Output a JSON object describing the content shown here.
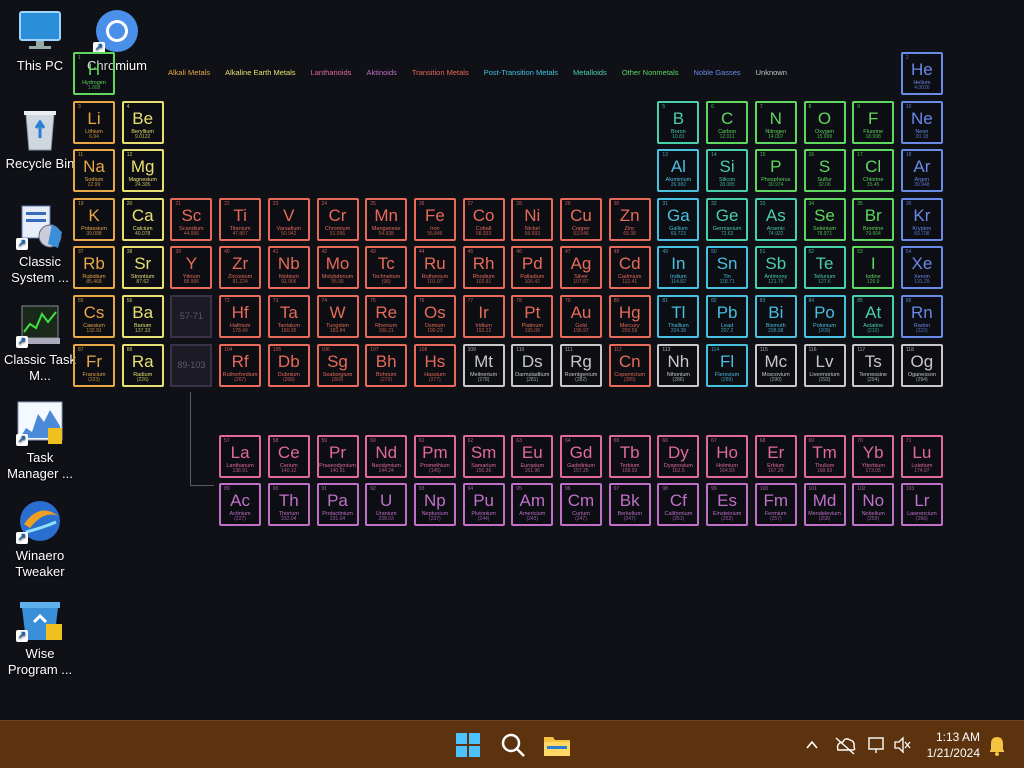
{
  "desktop": {
    "icons": [
      {
        "label": "This PC",
        "icon": "monitor-icon"
      },
      {
        "label": "Chromium",
        "icon": "chromium-icon"
      },
      {
        "label": "Recycle Bin",
        "icon": "recycle-bin-icon"
      },
      {
        "label": "Classic System ...",
        "icon": "system-properties-icon"
      },
      {
        "label": "Classic Task M...",
        "icon": "task-manager-icon"
      },
      {
        "label": "Task Manager ...",
        "icon": "task-manager-chart-icon"
      },
      {
        "label": "Winaero Tweaker",
        "icon": "winaero-icon"
      },
      {
        "label": "Wise Program ...",
        "icon": "wise-uninstaller-icon"
      }
    ]
  },
  "legend": [
    {
      "label": "Alkali Metals",
      "color": "#e8a848"
    },
    {
      "label": "Alkaline Earth Metals",
      "color": "#e8e070"
    },
    {
      "label": "Lanthanoids",
      "color": "#e06a9a"
    },
    {
      "label": "Aktinoids",
      "color": "#c070c8"
    },
    {
      "label": "Transition Metals",
      "color": "#e86a5a"
    },
    {
      "label": "Post-Transition Metals",
      "color": "#48c0e0"
    },
    {
      "label": "Metalloids",
      "color": "#48d0a8"
    },
    {
      "label": "Other Nonmetals",
      "color": "#60d860"
    },
    {
      "label": "Noble Gasses",
      "color": "#6a8ae8"
    },
    {
      "label": "Unknown",
      "color": "#c8c8c8"
    }
  ],
  "category_colors": {
    "alkali": "#e8a848",
    "alkaline": "#e8e070",
    "lanthanoid": "#e06a9a",
    "actinoid": "#c070c8",
    "transition": "#e86a5a",
    "post": "#48c0e0",
    "metalloid": "#48d0a8",
    "nonmetal": "#60d860",
    "noble": "#6a8ae8",
    "unknown": "#c8c8c8"
  },
  "elements": [
    [
      "1",
      "H",
      "Hydrogen",
      "1.008",
      1,
      1,
      "nonmetal"
    ],
    [
      "2",
      "He",
      "Helium",
      "4.0026",
      1,
      18,
      "noble"
    ],
    [
      "3",
      "Li",
      "Lithium",
      "6.94",
      2,
      1,
      "alkali"
    ],
    [
      "4",
      "Be",
      "Beryllium",
      "9.0122",
      2,
      2,
      "alkaline"
    ],
    [
      "5",
      "B",
      "Boron",
      "10.81",
      2,
      13,
      "metalloid"
    ],
    [
      "6",
      "C",
      "Carbon",
      "12.011",
      2,
      14,
      "nonmetal"
    ],
    [
      "7",
      "N",
      "Nitrogen",
      "14.007",
      2,
      15,
      "nonmetal"
    ],
    [
      "8",
      "O",
      "Oxygen",
      "15.999",
      2,
      16,
      "nonmetal"
    ],
    [
      "9",
      "F",
      "Fluorine",
      "18.998",
      2,
      17,
      "nonmetal"
    ],
    [
      "10",
      "Ne",
      "Neon",
      "20.18",
      2,
      18,
      "noble"
    ],
    [
      "11",
      "Na",
      "Sodium",
      "22.99",
      3,
      1,
      "alkali"
    ],
    [
      "12",
      "Mg",
      "Magnesium",
      "24.305",
      3,
      2,
      "alkaline"
    ],
    [
      "13",
      "Al",
      "Aluminium",
      "26.982",
      3,
      13,
      "post"
    ],
    [
      "14",
      "Si",
      "Silicon",
      "28.085",
      3,
      14,
      "metalloid"
    ],
    [
      "15",
      "P",
      "Phosphorus",
      "30.974",
      3,
      15,
      "nonmetal"
    ],
    [
      "16",
      "S",
      "Sulfur",
      "32.06",
      3,
      16,
      "nonmetal"
    ],
    [
      "17",
      "Cl",
      "Chlorine",
      "35.45",
      3,
      17,
      "nonmetal"
    ],
    [
      "18",
      "Ar",
      "Argon",
      "39.948",
      3,
      18,
      "noble"
    ],
    [
      "19",
      "K",
      "Potassium",
      "39.098",
      4,
      1,
      "alkali"
    ],
    [
      "20",
      "Ca",
      "Calcium",
      "40.078",
      4,
      2,
      "alkaline"
    ],
    [
      "21",
      "Sc",
      "Scandium",
      "44.956",
      4,
      3,
      "transition"
    ],
    [
      "22",
      "Ti",
      "Titanium",
      "47.867",
      4,
      4,
      "transition"
    ],
    [
      "23",
      "V",
      "Vanadium",
      "50.942",
      4,
      5,
      "transition"
    ],
    [
      "24",
      "Cr",
      "Chromium",
      "51.996",
      4,
      6,
      "transition"
    ],
    [
      "25",
      "Mn",
      "Manganese",
      "54.938",
      4,
      7,
      "transition"
    ],
    [
      "26",
      "Fe",
      "Iron",
      "55.845",
      4,
      8,
      "transition"
    ],
    [
      "27",
      "Co",
      "Cobalt",
      "58.933",
      4,
      9,
      "transition"
    ],
    [
      "28",
      "Ni",
      "Nickel",
      "58.693",
      4,
      10,
      "transition"
    ],
    [
      "29",
      "Cu",
      "Copper",
      "63.546",
      4,
      11,
      "transition"
    ],
    [
      "30",
      "Zn",
      "Zinc",
      "65.38",
      4,
      12,
      "transition"
    ],
    [
      "31",
      "Ga",
      "Gallium",
      "69.723",
      4,
      13,
      "post"
    ],
    [
      "32",
      "Ge",
      "Germanium",
      "72.63",
      4,
      14,
      "metalloid"
    ],
    [
      "33",
      "As",
      "Arsenic",
      "74.922",
      4,
      15,
      "metalloid"
    ],
    [
      "34",
      "Se",
      "Selenium",
      "78.971",
      4,
      16,
      "nonmetal"
    ],
    [
      "35",
      "Br",
      "Bromine",
      "79.904",
      4,
      17,
      "nonmetal"
    ],
    [
      "36",
      "Kr",
      "Krypton",
      "83.798",
      4,
      18,
      "noble"
    ],
    [
      "37",
      "Rb",
      "Rubidium",
      "85.468",
      5,
      1,
      "alkali"
    ],
    [
      "38",
      "Sr",
      "Strontium",
      "87.62",
      5,
      2,
      "alkaline"
    ],
    [
      "39",
      "Y",
      "Yttrium",
      "88.906",
      5,
      3,
      "transition"
    ],
    [
      "40",
      "Zr",
      "Zirconium",
      "91.224",
      5,
      4,
      "transition"
    ],
    [
      "41",
      "Nb",
      "Niobium",
      "92.906",
      5,
      5,
      "transition"
    ],
    [
      "42",
      "Mo",
      "Molybdenum",
      "95.95",
      5,
      6,
      "transition"
    ],
    [
      "43",
      "Tc",
      "Technetium",
      "(98)",
      5,
      7,
      "transition"
    ],
    [
      "44",
      "Ru",
      "Ruthenium",
      "101.07",
      5,
      8,
      "transition"
    ],
    [
      "45",
      "Rh",
      "Rhodium",
      "102.91",
      5,
      9,
      "transition"
    ],
    [
      "46",
      "Pd",
      "Palladium",
      "106.42",
      5,
      10,
      "transition"
    ],
    [
      "47",
      "Ag",
      "Silver",
      "107.87",
      5,
      11,
      "transition"
    ],
    [
      "48",
      "Cd",
      "Cadmium",
      "112.41",
      5,
      12,
      "transition"
    ],
    [
      "49",
      "In",
      "Indium",
      "114.82",
      5,
      13,
      "post"
    ],
    [
      "50",
      "Sn",
      "Tin",
      "118.71",
      5,
      14,
      "post"
    ],
    [
      "51",
      "Sb",
      "Antimony",
      "121.76",
      5,
      15,
      "metalloid"
    ],
    [
      "52",
      "Te",
      "Tellurium",
      "127.6",
      5,
      16,
      "metalloid"
    ],
    [
      "53",
      "I",
      "Iodine",
      "126.9",
      5,
      17,
      "nonmetal"
    ],
    [
      "54",
      "Xe",
      "Xenon",
      "131.29",
      5,
      18,
      "noble"
    ],
    [
      "55",
      "Cs",
      "Caesium",
      "132.91",
      6,
      1,
      "alkali"
    ],
    [
      "56",
      "Ba",
      "Barium",
      "137.33",
      6,
      2,
      "alkaline"
    ],
    [
      "72",
      "Hf",
      "Hafnium",
      "178.49",
      6,
      4,
      "transition"
    ],
    [
      "73",
      "Ta",
      "Tantalum",
      "180.95",
      6,
      5,
      "transition"
    ],
    [
      "74",
      "W",
      "Tungsten",
      "183.84",
      6,
      6,
      "transition"
    ],
    [
      "75",
      "Re",
      "Rhenium",
      "186.21",
      6,
      7,
      "transition"
    ],
    [
      "76",
      "Os",
      "Osmium",
      "190.23",
      6,
      8,
      "transition"
    ],
    [
      "77",
      "Ir",
      "Iridium",
      "192.22",
      6,
      9,
      "transition"
    ],
    [
      "78",
      "Pt",
      "Platinum",
      "195.08",
      6,
      10,
      "transition"
    ],
    [
      "79",
      "Au",
      "Gold",
      "196.97",
      6,
      11,
      "transition"
    ],
    [
      "80",
      "Hg",
      "Mercury",
      "200.59",
      6,
      12,
      "transition"
    ],
    [
      "81",
      "Tl",
      "Thallium",
      "204.38",
      6,
      13,
      "post"
    ],
    [
      "82",
      "Pb",
      "Lead",
      "207.2",
      6,
      14,
      "post"
    ],
    [
      "83",
      "Bi",
      "Bismuth",
      "208.98",
      6,
      15,
      "post"
    ],
    [
      "84",
      "Po",
      "Polonium",
      "(209)",
      6,
      16,
      "post"
    ],
    [
      "85",
      "At",
      "Astatine",
      "(210)",
      6,
      17,
      "metalloid"
    ],
    [
      "86",
      "Rn",
      "Radon",
      "(222)",
      6,
      18,
      "noble"
    ],
    [
      "87",
      "Fr",
      "Francium",
      "(223)",
      7,
      1,
      "alkali"
    ],
    [
      "88",
      "Ra",
      "Radium",
      "(226)",
      7,
      2,
      "alkaline"
    ],
    [
      "104",
      "Rf",
      "Rutherfordium",
      "(267)",
      7,
      4,
      "transition"
    ],
    [
      "105",
      "Db",
      "Dubnium",
      "(268)",
      7,
      5,
      "transition"
    ],
    [
      "106",
      "Sg",
      "Seaborgium",
      "(269)",
      7,
      6,
      "transition"
    ],
    [
      "107",
      "Bh",
      "Bohrium",
      "(270)",
      7,
      7,
      "transition"
    ],
    [
      "108",
      "Hs",
      "Hassium",
      "(277)",
      7,
      8,
      "transition"
    ],
    [
      "109",
      "Mt",
      "Meitnerium",
      "(278)",
      7,
      9,
      "unknown"
    ],
    [
      "110",
      "Ds",
      "Darmstadtium",
      "(281)",
      7,
      10,
      "unknown"
    ],
    [
      "111",
      "Rg",
      "Roentgenium",
      "(282)",
      7,
      11,
      "unknown"
    ],
    [
      "112",
      "Cn",
      "Copernicium",
      "(285)",
      7,
      12,
      "transition"
    ],
    [
      "113",
      "Nh",
      "Nihonium",
      "(286)",
      7,
      13,
      "unknown"
    ],
    [
      "114",
      "Fl",
      "Flerovium",
      "(289)",
      7,
      14,
      "post"
    ],
    [
      "115",
      "Mc",
      "Moscovium",
      "(290)",
      7,
      15,
      "unknown"
    ],
    [
      "116",
      "Lv",
      "Livermorium",
      "(293)",
      7,
      16,
      "unknown"
    ],
    [
      "117",
      "Ts",
      "Tennessine",
      "(294)",
      7,
      17,
      "unknown"
    ],
    [
      "118",
      "Og",
      "Oganesson",
      "(294)",
      7,
      18,
      "unknown"
    ],
    [
      "57",
      "La",
      "Lanthanum",
      "138.91",
      9,
      4,
      "lanthanoid"
    ],
    [
      "58",
      "Ce",
      "Cerium",
      "140.12",
      9,
      5,
      "lanthanoid"
    ],
    [
      "59",
      "Pr",
      "Praseodymium",
      "140.91",
      9,
      6,
      "lanthanoid"
    ],
    [
      "60",
      "Nd",
      "Neodymium",
      "144.24",
      9,
      7,
      "lanthanoid"
    ],
    [
      "61",
      "Pm",
      "Promethium",
      "(145)",
      9,
      8,
      "lanthanoid"
    ],
    [
      "62",
      "Sm",
      "Samarium",
      "150.36",
      9,
      9,
      "lanthanoid"
    ],
    [
      "63",
      "Eu",
      "Europium",
      "151.96",
      9,
      10,
      "lanthanoid"
    ],
    [
      "64",
      "Gd",
      "Gadolinium",
      "157.25",
      9,
      11,
      "lanthanoid"
    ],
    [
      "65",
      "Tb",
      "Terbium",
      "158.93",
      9,
      12,
      "lanthanoid"
    ],
    [
      "66",
      "Dy",
      "Dysprosium",
      "162.5",
      9,
      13,
      "lanthanoid"
    ],
    [
      "67",
      "Ho",
      "Holmium",
      "164.93",
      9,
      14,
      "lanthanoid"
    ],
    [
      "68",
      "Er",
      "Erbium",
      "167.26",
      9,
      15,
      "lanthanoid"
    ],
    [
      "69",
      "Tm",
      "Thulium",
      "168.93",
      9,
      16,
      "lanthanoid"
    ],
    [
      "70",
      "Yb",
      "Ytterbium",
      "173.05",
      9,
      17,
      "lanthanoid"
    ],
    [
      "71",
      "Lu",
      "Lutetium",
      "174.97",
      9,
      18,
      "lanthanoid"
    ],
    [
      "89",
      "Ac",
      "Actinium",
      "(227)",
      10,
      4,
      "actinoid"
    ],
    [
      "90",
      "Th",
      "Thorium",
      "232.04",
      10,
      5,
      "actinoid"
    ],
    [
      "91",
      "Pa",
      "Protactinium",
      "231.04",
      10,
      6,
      "actinoid"
    ],
    [
      "92",
      "U",
      "Uranium",
      "238.03",
      10,
      7,
      "actinoid"
    ],
    [
      "93",
      "Np",
      "Neptunium",
      "(237)",
      10,
      8,
      "actinoid"
    ],
    [
      "94",
      "Pu",
      "Plutonium",
      "(244)",
      10,
      9,
      "actinoid"
    ],
    [
      "95",
      "Am",
      "Americium",
      "(243)",
      10,
      10,
      "actinoid"
    ],
    [
      "96",
      "Cm",
      "Curium",
      "(247)",
      10,
      11,
      "actinoid"
    ],
    [
      "97",
      "Bk",
      "Berkelium",
      "(247)",
      10,
      12,
      "actinoid"
    ],
    [
      "98",
      "Cf",
      "Californium",
      "(251)",
      10,
      13,
      "actinoid"
    ],
    [
      "99",
      "Es",
      "Einsteinium",
      "(252)",
      10,
      14,
      "actinoid"
    ],
    [
      "100",
      "Fm",
      "Fermium",
      "(257)",
      10,
      15,
      "actinoid"
    ],
    [
      "101",
      "Md",
      "Mendelevium",
      "(258)",
      10,
      16,
      "actinoid"
    ],
    [
      "102",
      "No",
      "Nobelium",
      "(259)",
      10,
      17,
      "actinoid"
    ],
    [
      "103",
      "Lr",
      "Lawrencium",
      "(266)",
      10,
      18,
      "actinoid"
    ]
  ],
  "placeholders": [
    {
      "label": "57-71",
      "row": 6,
      "col": 3
    },
    {
      "label": "89-103",
      "row": 7,
      "col": 3
    }
  ],
  "taskbar": {
    "start": "start-icon",
    "search": "search-icon",
    "explorer": "file-explorer-icon",
    "time": "1:13 AM",
    "date": "1/21/2024"
  }
}
